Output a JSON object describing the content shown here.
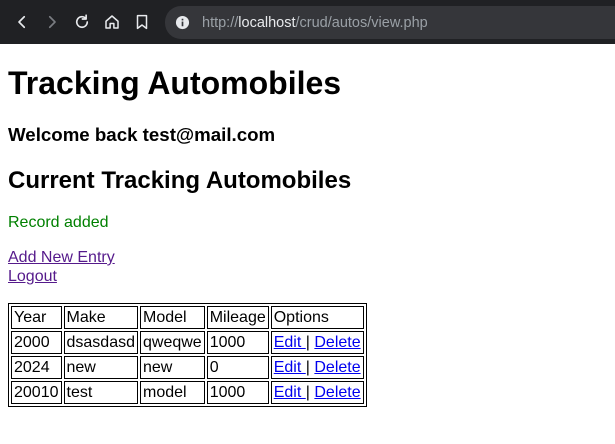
{
  "browser": {
    "url_scheme": "http://",
    "url_host": "localhost",
    "url_path": "/crud/autos/view.php"
  },
  "page": {
    "title": "Tracking Automobiles",
    "welcome": "Welcome back test@mail.com",
    "subtitle": "Current Tracking Automobiles",
    "flash": "Record added",
    "flash_color": "#008000",
    "add_link": "Add New Entry",
    "logout_link": "Logout"
  },
  "table": {
    "headers": [
      "Year",
      "Make",
      "Model",
      "Mileage",
      "Options"
    ],
    "rows": [
      {
        "year": "2000",
        "make": "dsasdasd",
        "model": "qweqwe",
        "mileage": "1000",
        "edit": "Edit ",
        "sep": "|",
        "delete": "Delete"
      },
      {
        "year": "2024",
        "make": "new",
        "model": "new",
        "mileage": "0",
        "edit": "Edit ",
        "sep": "|",
        "delete": "Delete"
      },
      {
        "year": "20010",
        "make": "test",
        "model": "model",
        "mileage": "1000",
        "edit": "Edit ",
        "sep": "|",
        "delete": "Delete"
      }
    ]
  }
}
